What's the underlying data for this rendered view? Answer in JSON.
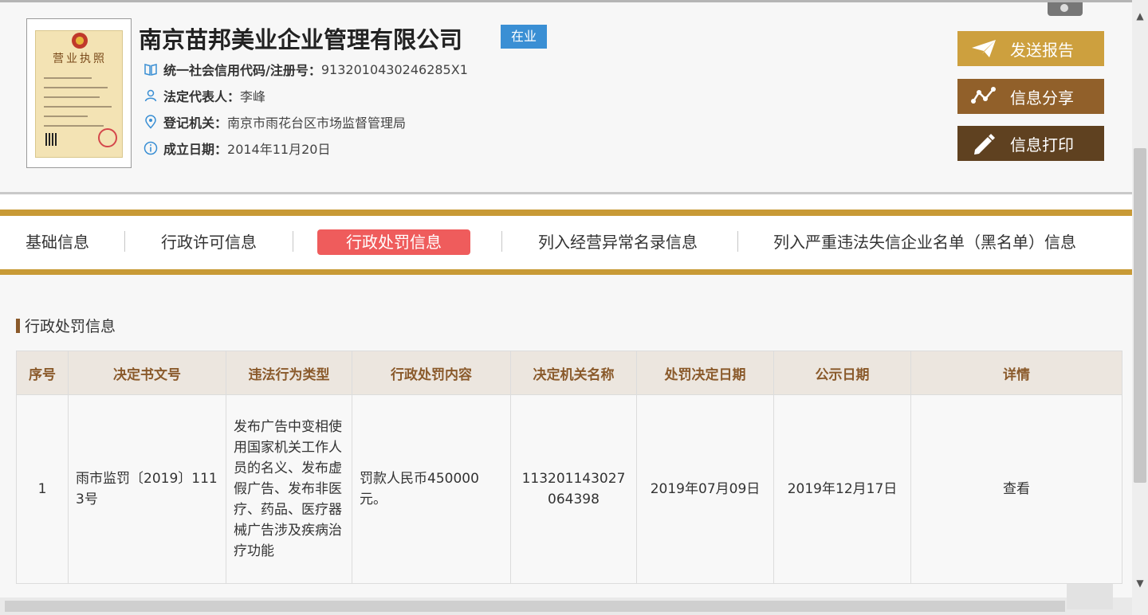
{
  "company": {
    "name": "南京苗邦美业企业管理有限公司",
    "status": "在业",
    "license_image_title": "营业执照",
    "fields": [
      {
        "label": "统一社会信用代码/注册号：",
        "value": "9132010430246285X1",
        "icon": "book-icon"
      },
      {
        "label": "法定代表人：",
        "value": "李峰",
        "icon": "person-icon"
      },
      {
        "label": "登记机关：",
        "value": "南京市雨花台区市场监督管理局",
        "icon": "location-pin-icon"
      },
      {
        "label": "成立日期：",
        "value": "2014年11月20日",
        "icon": "info-circle-icon"
      }
    ]
  },
  "actions": {
    "send_report": "发送报告",
    "share_info": "信息分享",
    "print_info": "信息打印"
  },
  "nav": {
    "tabs": [
      {
        "label": "基础信息",
        "active": false
      },
      {
        "label": "行政许可信息",
        "active": false
      },
      {
        "label": "行政处罚信息",
        "active": true
      },
      {
        "label": "列入经营异常名录信息",
        "active": false
      },
      {
        "label": "列入严重违法失信企业名单（黑名单）信息",
        "active": false
      }
    ]
  },
  "section": {
    "title": "行政处罚信息"
  },
  "table": {
    "headers": [
      "序号",
      "决定书文号",
      "违法行为类型",
      "行政处罚内容",
      "决定机关名称",
      "处罚决定日期",
      "公示日期",
      "详情"
    ],
    "rows": [
      {
        "index": "1",
        "doc_no": "雨市监罚〔2019〕1113号",
        "violation_type": "发布广告中变相使用国家机关工作人员的名义、发布虚假广告、发布非医疗、药品、医疗器械广告涉及疾病治疗功能",
        "penalty": "罚款人民币450000元。",
        "authority": "113201143027064398",
        "decision_date": "2019年07月09日",
        "publish_date": "2019年12月17日",
        "detail": "查看"
      }
    ]
  },
  "colors": {
    "gold": "#c89a36",
    "active_tab": "#ef5c5c",
    "status_badge": "#3a8fd4",
    "header_text": "#8a5a2b",
    "link": "#e8a162"
  }
}
